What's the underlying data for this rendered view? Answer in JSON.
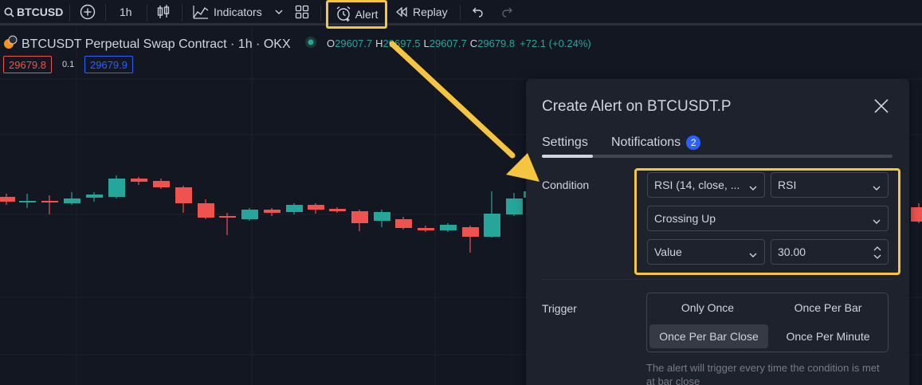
{
  "toolbar": {
    "symbol": "BTCUSD",
    "interval": "1h",
    "indicators_label": "Indicators",
    "alert_label": "Alert",
    "replay_label": "Replay"
  },
  "legend": {
    "title": "BTCUSDT Perpetual Swap Contract · 1h · OKX",
    "ohlc": [
      {
        "key": "O",
        "value": "29607.7"
      },
      {
        "key": "H",
        "value": "29697.5"
      },
      {
        "key": "L",
        "value": "29607.7"
      },
      {
        "key": "C",
        "value": "29679.8"
      }
    ],
    "change": "+72.1 (+0.24%)",
    "bid": "29679.8",
    "spread": "0.1",
    "ask": "29679.9"
  },
  "dialog": {
    "title": "Create Alert on BTCUSDT.P",
    "tabs": [
      {
        "label": "Settings",
        "active": true
      },
      {
        "label": "Notifications",
        "badge": "2"
      }
    ],
    "condition_label": "Condition",
    "condition": {
      "indicator": "RSI (14, close, ...",
      "plot": "RSI",
      "operator": "Crossing Up",
      "compare_type": "Value",
      "compare_value": "30.00"
    },
    "trigger_label": "Trigger",
    "trigger_options": [
      "Only Once",
      "Once Per Bar",
      "Once Per Bar Close",
      "Once Per Minute"
    ],
    "trigger_selected": "Once Per Bar Close",
    "hint": "The alert will trigger every time the condition is met at bar close"
  },
  "colors": {
    "up": "#26a69a",
    "down": "#ef5350",
    "highlight": "#f5c542",
    "accent": "#2962ff",
    "background": "#131722",
    "panel": "#1e222d"
  }
}
